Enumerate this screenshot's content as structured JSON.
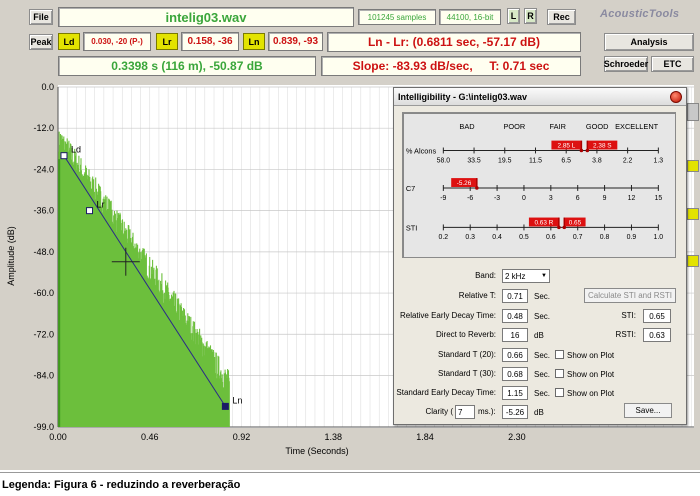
{
  "toolbar": {
    "file_label": "File",
    "filename": "intelig03.wav",
    "samples": "101245 samples",
    "format": "44100, 16-bit",
    "l_label": "L",
    "r_label": "R",
    "rec_label": "Rec",
    "brand": "AcousticTools"
  },
  "row2": {
    "peak_label": "Peak",
    "ld_label": "Ld",
    "ld_value": "0.030, -20 (P-)",
    "lr_label": "Lr",
    "lr_value": "0.158, -36",
    "ln_label": "Ln",
    "ln_value": "0.839, -93",
    "diff_text": "Ln - Lr: (0.6811 sec, -57.17 dB)"
  },
  "row3": {
    "cursor_text": "0.3398 s (116 m), -50.87 dB",
    "slope_text": "Slope: -83.93 dB/sec,     T: 0.71 sec"
  },
  "right_buttons": {
    "analysis": "Analysis",
    "schroeder": "Schroeder",
    "etc": "ETC"
  },
  "plot": {
    "ylabel": "Amplitude (dB)",
    "xlabel": "Time (Seconds)",
    "yticks": [
      "0.0",
      "-12.0",
      "-24.0",
      "-36.0",
      "-48.0",
      "-60.0",
      "-72.0",
      "-84.0",
      "-99.0"
    ],
    "xticks": [
      "0.00",
      "0.46",
      "0.92",
      "1.38",
      "1.84",
      "2.30"
    ],
    "markers": [
      {
        "label": "Ld",
        "t": 0.03,
        "db": -20
      },
      {
        "label": "Lr",
        "t": 0.158,
        "db": -36
      },
      {
        "label": "Ln",
        "t": 0.839,
        "db": -93
      }
    ],
    "cursor": {
      "t": 0.3398,
      "db": -50.87
    },
    "colors": {
      "signal": "#6cbf3c",
      "line": "#2a2a88",
      "grid": "#d8d8d8"
    }
  },
  "dialog": {
    "title": "Intelligibility - G:\\intelig03.wav",
    "categories": [
      "BAD",
      "POOR",
      "FAIR",
      "GOOD",
      "EXCELLENT"
    ],
    "alcons_label": "% Alcons",
    "alcons_ticks": [
      "58.0",
      "33.5",
      "19.5",
      "11.5",
      "6.5",
      "3.8",
      "2.2",
      "1.3"
    ],
    "alcons_markers": [
      "2.85 L",
      "2.38 S"
    ],
    "c7_label": "C7",
    "c7_ticks": [
      "-9",
      "-6",
      "-3",
      "0",
      "3",
      "6",
      "9",
      "12",
      "15"
    ],
    "c7_marker": "-5.26",
    "sti_label": "STI",
    "sti_ticks": [
      "0.2",
      "0.3",
      "0.4",
      "0.5",
      "0.6",
      "0.7",
      "0.8",
      "0.9",
      "1.0"
    ],
    "sti_markers": [
      "0.63 R",
      "0.65"
    ],
    "band_label": "Band:",
    "band_value": "2 kHz",
    "rel_t_label": "Relative T:",
    "rel_t_value": "0.71",
    "rel_edt_label": "Relative Early Decay Time:",
    "rel_edt_value": "0.48",
    "d2r_label": "Direct to Reverb:",
    "d2r_value": "16",
    "st20_label": "Standard T (20):",
    "st20_value": "0.66",
    "st30_label": "Standard T (30):",
    "st30_value": "0.68",
    "sedt_label": "Standard Early Decay Time:",
    "sedt_value": "1.15",
    "clarity_label": "Clarity (",
    "clarity_ms": "7",
    "clarity_ms_suffix": "ms.):",
    "clarity_value": "-5.26",
    "unit_sec": "Sec.",
    "unit_db": "dB",
    "show_on_plot": "Show on Plot",
    "calc_button": "Calculate STI and RSTI",
    "sti_out_label": "STI:",
    "sti_out_value": "0.65",
    "rsti_out_label": "RSTI:",
    "rsti_out_value": "0.63",
    "save_button": "Save..."
  },
  "caption": "Legenda: Figura 6 - reduzindo a reverberação"
}
